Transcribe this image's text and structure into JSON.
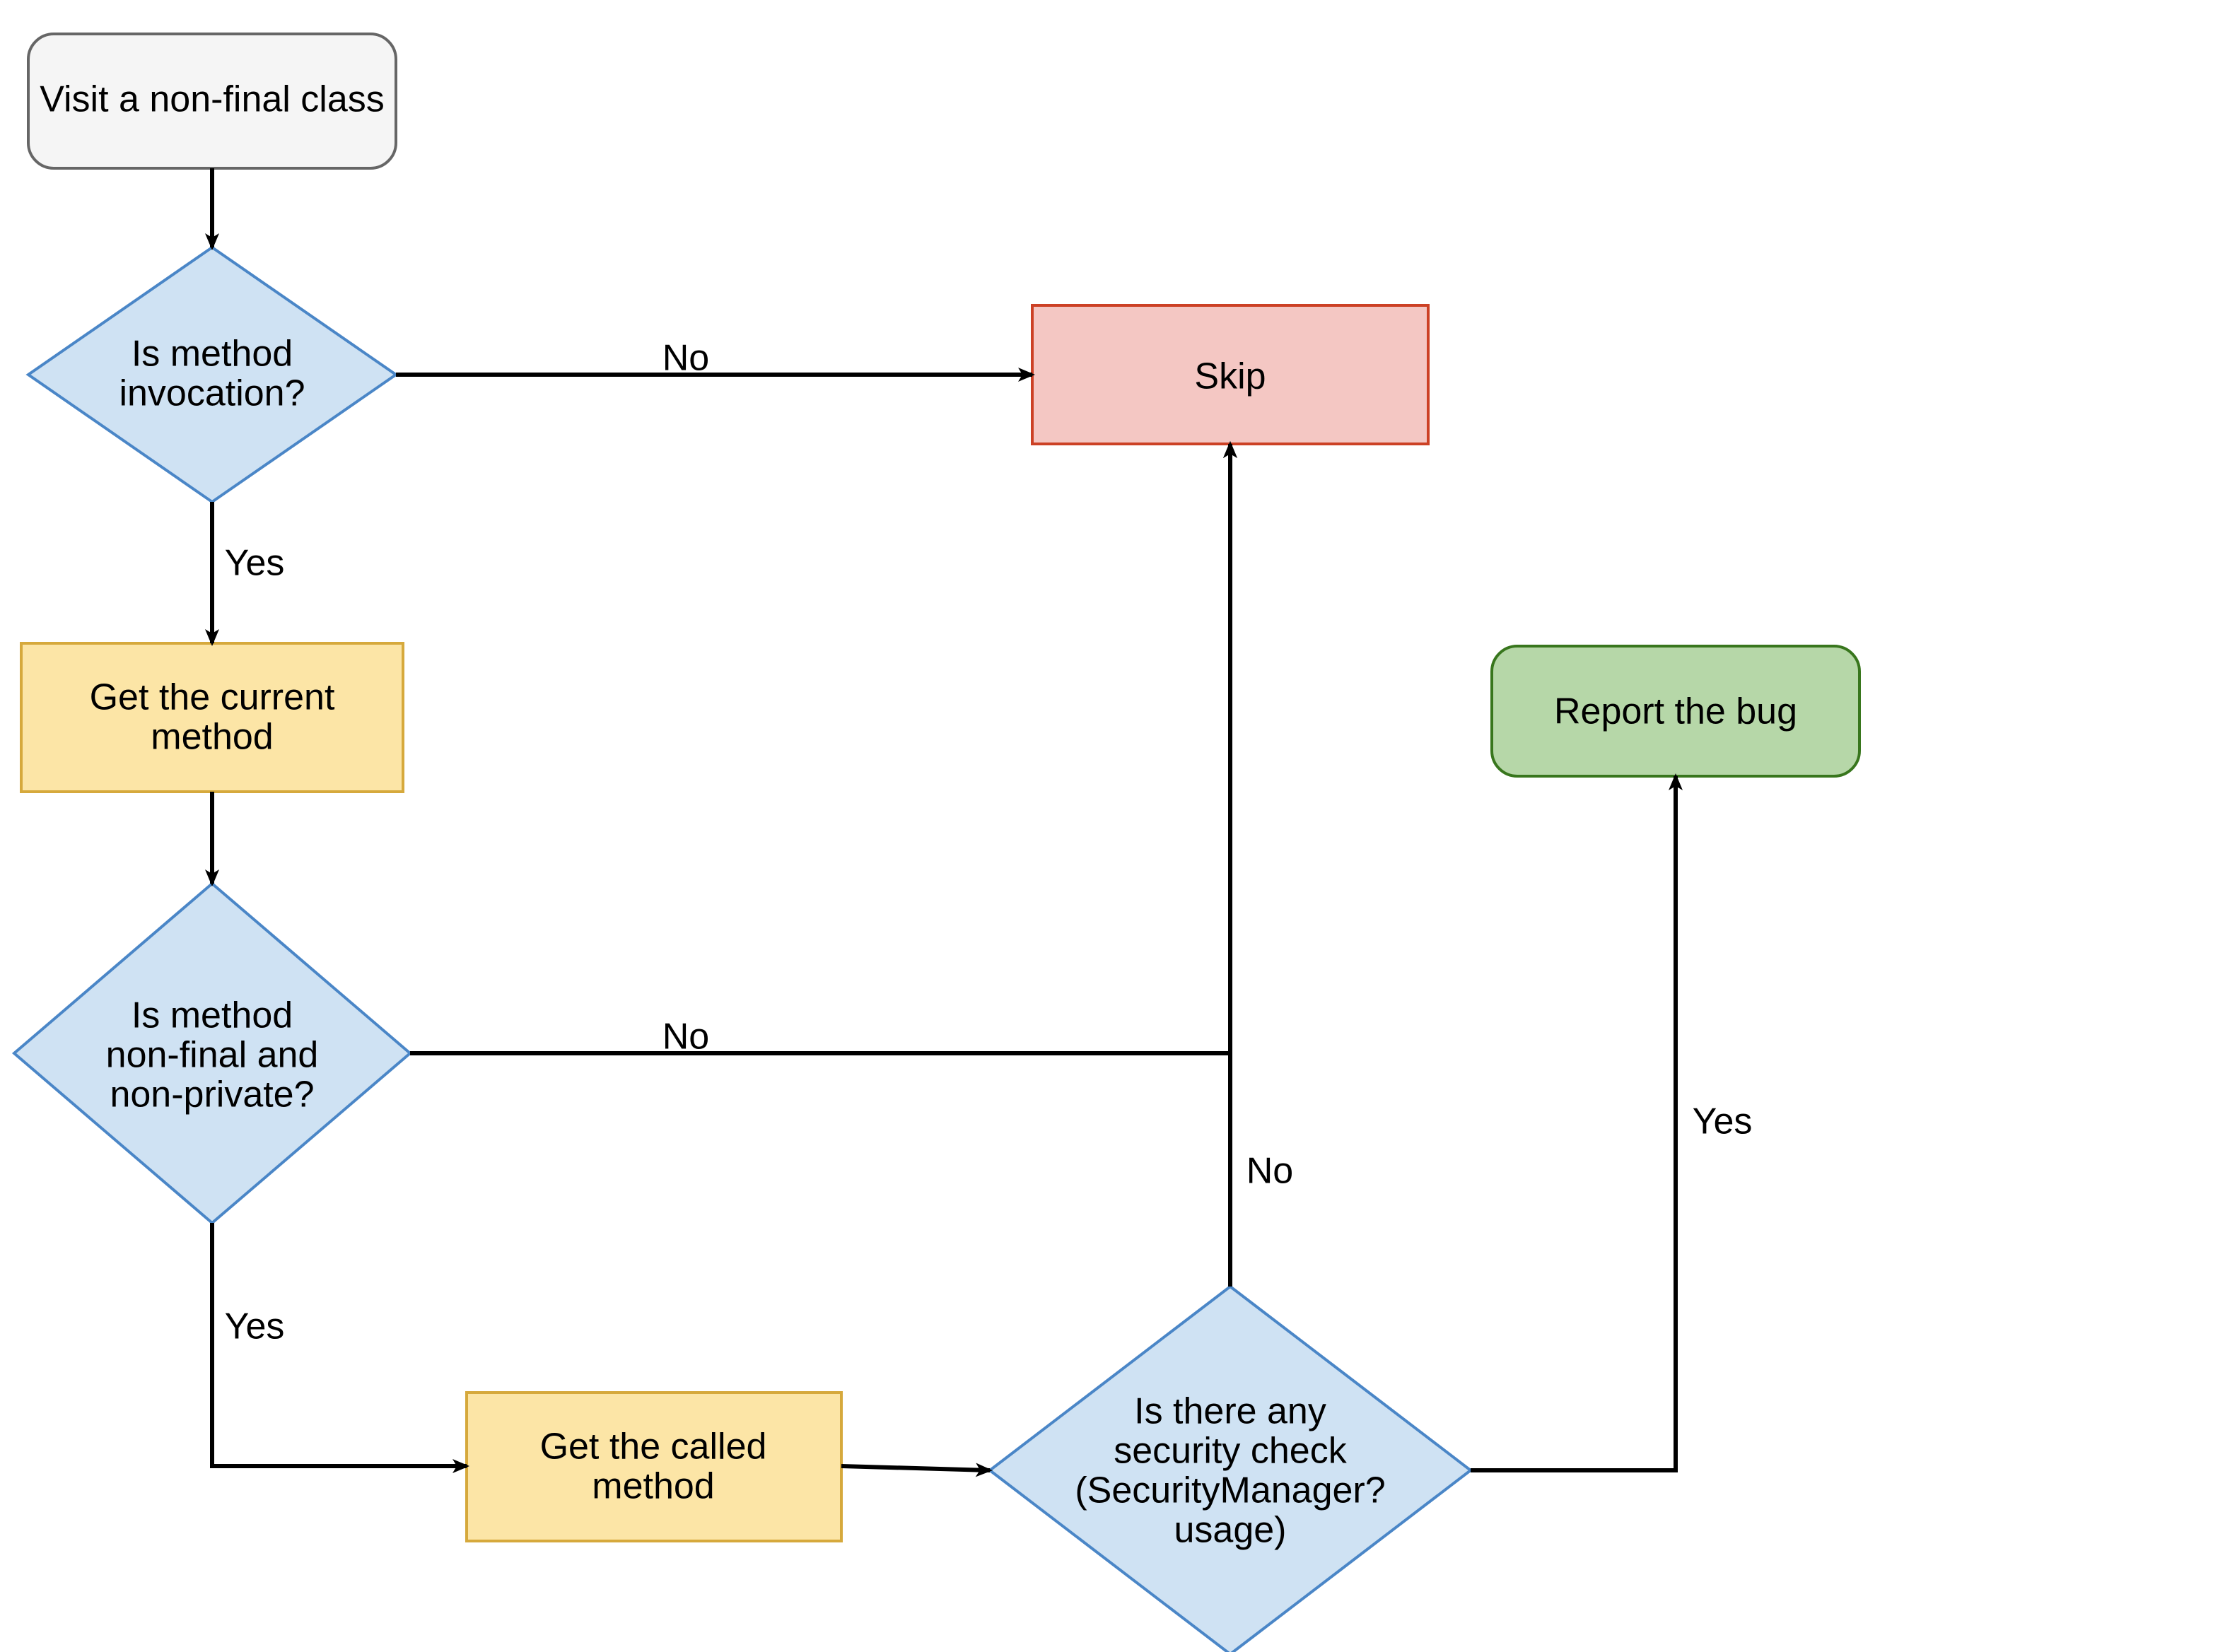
{
  "nodes": {
    "start": {
      "lines": [
        "Visit a non-final class"
      ]
    },
    "decision1": {
      "lines": [
        "Is method",
        "invocation?"
      ]
    },
    "process1": {
      "lines": [
        "Get the current",
        "method"
      ]
    },
    "decision2": {
      "lines": [
        "Is method",
        "non-final and",
        "non-private?"
      ]
    },
    "process2": {
      "lines": [
        "Get the called",
        "method"
      ]
    },
    "decision3": {
      "lines": [
        "Is there any",
        "security check",
        "(SecurityManager?",
        "usage)"
      ]
    },
    "skip": {
      "lines": [
        "Skip"
      ]
    },
    "report": {
      "lines": [
        "Report the bug"
      ]
    }
  },
  "edges": {
    "d1_yes": "Yes",
    "d1_no": "No",
    "d2_yes": "Yes",
    "d2_no": "No",
    "d3_yes": "Yes",
    "d3_no": "No"
  },
  "colors": {
    "start_fill": "#f5f5f5",
    "start_stroke": "#666666",
    "decision_fill": "#cfe2f3",
    "decision_stroke": "#4a86c7",
    "process_fill": "#fce5a6",
    "process_stroke": "#d6a93c",
    "skip_fill": "#f4c7c3",
    "skip_stroke": "#cc4125",
    "report_fill": "#b6d7a8",
    "report_stroke": "#38761d",
    "edge": "#000000"
  }
}
